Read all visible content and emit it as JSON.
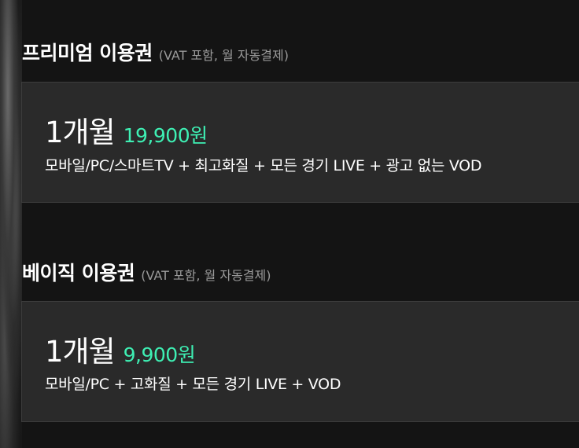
{
  "premium": {
    "title": "프리미엄 이용권",
    "note": "(VAT 포함, 월 자동결제)",
    "plan": {
      "duration": "1개월",
      "price": "19,900원",
      "features": "모바일/PC/스마트TV + 최고화질 + 모든 경기 LIVE + 광고 없는 VOD"
    }
  },
  "basic": {
    "title": "베이직 이용권",
    "note": "(VAT 포함, 월 자동결제)",
    "plan": {
      "duration": "1개월",
      "price": "9,900원",
      "features": "모바일/PC + 고화질 + 모든 경기 LIVE + VOD"
    }
  },
  "colors": {
    "background": "#141414",
    "card": "#2a2a2a",
    "price_accent": "#3ef0b4",
    "note": "#9a9a9a"
  }
}
